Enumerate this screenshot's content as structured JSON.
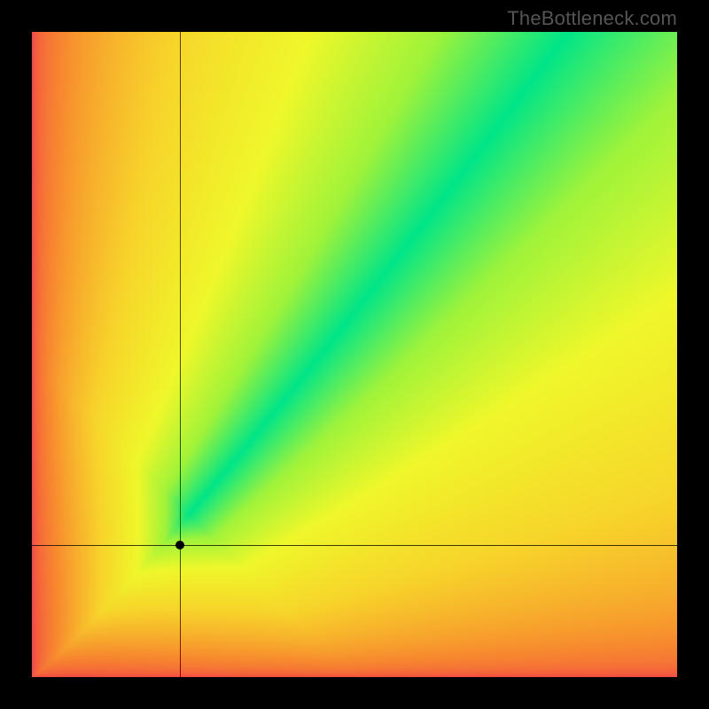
{
  "watermark": "TheBottleneck.com",
  "chart_data": {
    "type": "heatmap",
    "title": "",
    "xlabel": "",
    "ylabel": "",
    "xlim": [
      0,
      1
    ],
    "ylim": [
      0,
      1
    ],
    "grid": false,
    "legend": false,
    "marker": {
      "x": 0.23,
      "y": 0.205
    },
    "crosshair": {
      "x": 0.23,
      "y": 0.205
    },
    "optimal_band": {
      "description": "Green optimal diagonal band where y ≈ 1.23·x^1.12; color = compatibility score",
      "center_curve_samples": [
        {
          "x": 0.0,
          "y": 0.0
        },
        {
          "x": 0.1,
          "y": 0.093
        },
        {
          "x": 0.2,
          "y": 0.203
        },
        {
          "x": 0.3,
          "y": 0.32
        },
        {
          "x": 0.4,
          "y": 0.441
        },
        {
          "x": 0.5,
          "y": 0.566
        },
        {
          "x": 0.6,
          "y": 0.694
        },
        {
          "x": 0.7,
          "y": 0.824
        },
        {
          "x": 0.8,
          "y": 0.957
        },
        {
          "x": 0.9,
          "y": 1.092
        }
      ],
      "band_relative_halfwidth": 0.085
    },
    "color_scale": {
      "stops": [
        {
          "value": 0.0,
          "color": "#f1364a"
        },
        {
          "value": 0.35,
          "color": "#f78b2e"
        },
        {
          "value": 0.6,
          "color": "#f7d42a"
        },
        {
          "value": 0.78,
          "color": "#eff72a"
        },
        {
          "value": 0.9,
          "color": "#9ff33a"
        },
        {
          "value": 1.0,
          "color": "#00e588"
        }
      ]
    }
  }
}
